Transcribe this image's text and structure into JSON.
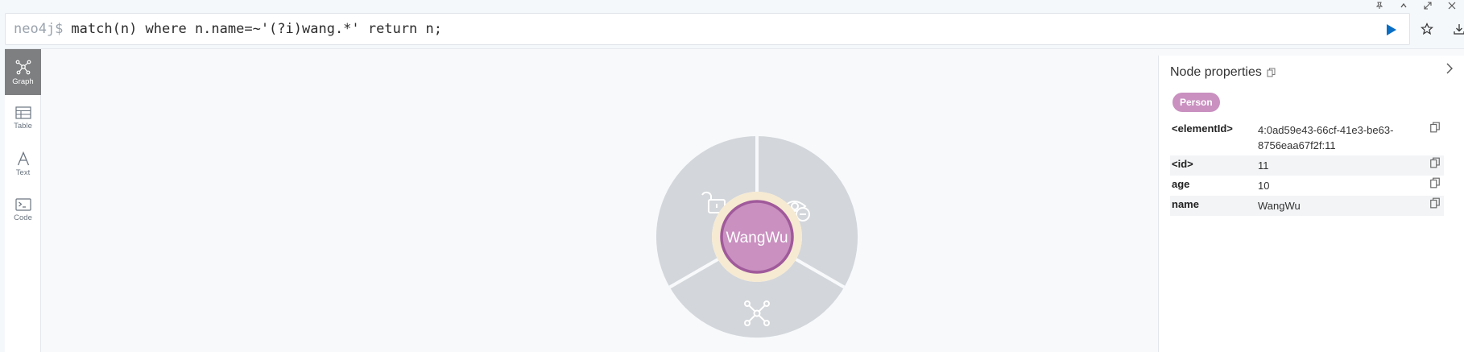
{
  "window": {
    "pin_icon": "pin-icon",
    "collapse_icon": "chevron-up-icon",
    "expand_icon": "expand-icon",
    "close_icon": "close-icon"
  },
  "editor": {
    "prompt": "neo4j$",
    "query": "match(n) where n.name=~'(?i)wang.*' return n;",
    "run_icon": "play-icon",
    "favorite_icon": "star-icon",
    "download_icon": "download-icon"
  },
  "sidebar": {
    "items": [
      {
        "label": "Graph",
        "icon": "graph-icon",
        "active": true
      },
      {
        "label": "Table",
        "icon": "table-icon",
        "active": false
      },
      {
        "label": "Text",
        "icon": "text-icon",
        "active": false
      },
      {
        "label": "Code",
        "icon": "code-icon",
        "active": false
      }
    ]
  },
  "graph": {
    "node": {
      "caption": "WangWu",
      "color": "#c990c0",
      "ring_color": "#f6ead2"
    },
    "ring_actions": [
      "unlock-icon",
      "hide-icon",
      "expand-neighbors-icon"
    ]
  },
  "properties": {
    "title": "Node properties",
    "label": "Person",
    "rows": [
      {
        "key": "<elementId>",
        "value": "4:0ad59e43-66cf-41e3-be63-8756eaa67f2f:11"
      },
      {
        "key": "<id>",
        "value": "11"
      },
      {
        "key": "age",
        "value": "10"
      },
      {
        "key": "name",
        "value": "WangWu"
      }
    ]
  },
  "colors": {
    "accent": "#0a6ec5",
    "label_pill": "#c990c0",
    "ring": "#d3d6da"
  }
}
